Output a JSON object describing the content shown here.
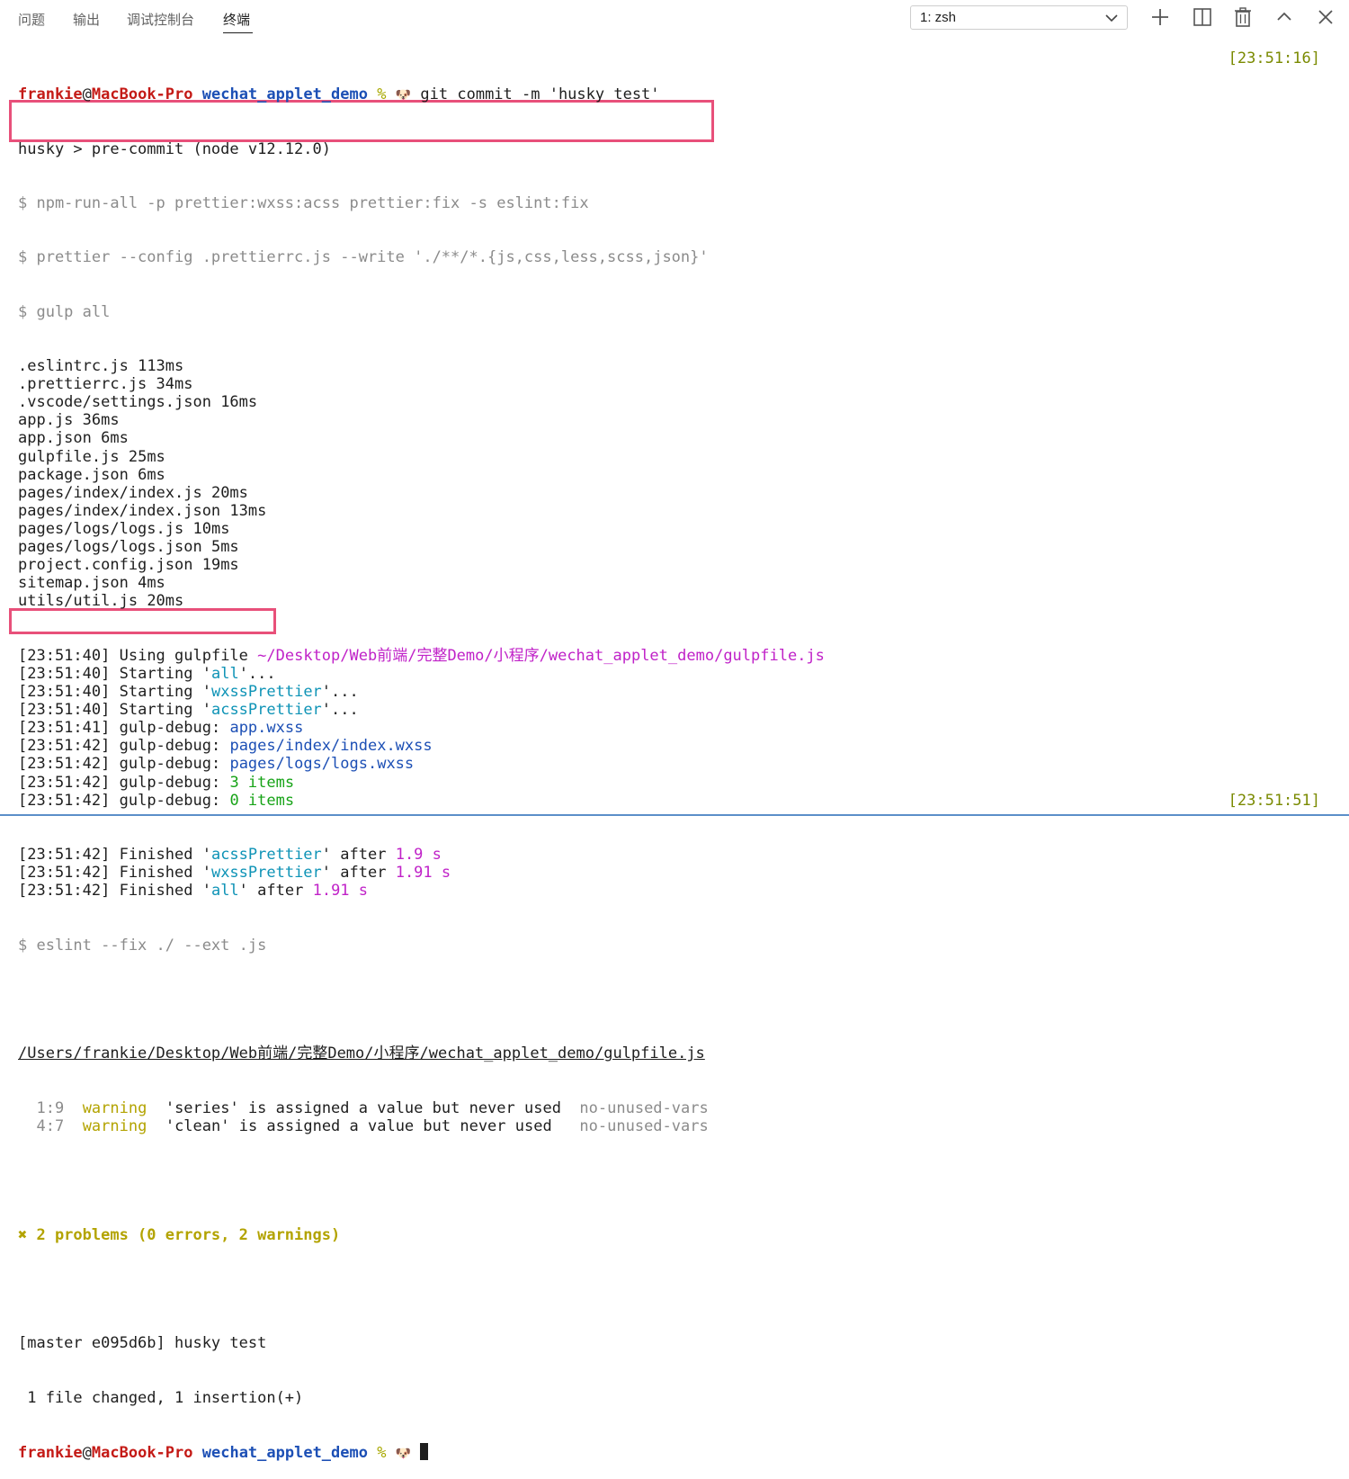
{
  "panel": {
    "tabs": [
      {
        "label": "问题"
      },
      {
        "label": "输出"
      },
      {
        "label": "调试控制台"
      },
      {
        "label": "终端"
      }
    ],
    "terminal_select": "1: zsh",
    "icons": [
      "plus-icon",
      "split-icon",
      "trash-icon",
      "chevron-up-icon",
      "close-icon"
    ]
  },
  "prompt": {
    "user": "frankie",
    "at": "@",
    "host": "MacBook-Pro",
    "dir": "wechat_applet_demo",
    "pct": "%",
    "dog": "🐶"
  },
  "first_command": "git commit -m 'husky test'",
  "first_time": "[23:51:16]",
  "last_time": "[23:51:51]",
  "lines": {
    "husky": "husky > pre-commit (node v12.12.0)",
    "npm_run_all": "$ npm-run-all -p prettier:wxss:acss prettier:fix -s eslint:fix",
    "prettier_cmd": "$ prettier --config .prettierrc.js --write './**/*.{js,css,less,scss,json}'",
    "gulp_all": "$ gulp all",
    "files": [
      {
        "name": ".eslintrc.js",
        "time": "113ms"
      },
      {
        "name": ".prettierrc.js",
        "time": "34ms"
      },
      {
        "name": ".vscode/settings.json",
        "time": "16ms"
      },
      {
        "name": "app.js",
        "time": "36ms"
      },
      {
        "name": "app.json",
        "time": "6ms"
      },
      {
        "name": "gulpfile.js",
        "time": "25ms"
      },
      {
        "name": "package.json",
        "time": "6ms"
      },
      {
        "name": "pages/index/index.js",
        "time": "20ms"
      },
      {
        "name": "pages/index/index.json",
        "time": "13ms"
      },
      {
        "name": "pages/logs/logs.js",
        "time": "10ms"
      },
      {
        "name": "pages/logs/logs.json",
        "time": "5ms"
      },
      {
        "name": "project.config.json",
        "time": "19ms"
      },
      {
        "name": "sitemap.json",
        "time": "4ms"
      },
      {
        "name": "utils/util.js",
        "time": "20ms"
      }
    ],
    "gulp": [
      {
        "ts": "[23:51:40]",
        "text": "Using gulpfile",
        "hi": "~/Desktop/Web前端/完整Demo/小程序/wechat_applet_demo/gulpfile.js",
        "cls": "magenta",
        "tail": ""
      },
      {
        "ts": "[23:51:40]",
        "text": "Starting '",
        "hi": "all",
        "cls": "cyan",
        "tail": "'..."
      },
      {
        "ts": "[23:51:40]",
        "text": "Starting '",
        "hi": "wxssPrettier",
        "cls": "cyan",
        "tail": "'..."
      },
      {
        "ts": "[23:51:40]",
        "text": "Starting '",
        "hi": "acssPrettier",
        "cls": "cyan",
        "tail": "'..."
      },
      {
        "ts": "[23:51:41]",
        "text": "gulp-debug:",
        "hi": "app.wxss",
        "cls": "blue",
        "tail": ""
      },
      {
        "ts": "[23:51:42]",
        "text": "gulp-debug:",
        "hi": "pages/index/index.wxss",
        "cls": "blue",
        "tail": ""
      },
      {
        "ts": "[23:51:42]",
        "text": "gulp-debug:",
        "hi": "pages/logs/logs.wxss",
        "cls": "blue",
        "tail": ""
      },
      {
        "ts": "[23:51:42]",
        "text": "gulp-debug:",
        "hi": "3 items",
        "cls": "green",
        "tail": ""
      },
      {
        "ts": "[23:51:42]",
        "text": "gulp-debug:",
        "hi": "0 items",
        "cls": "green",
        "tail": ""
      }
    ],
    "finished": [
      {
        "ts": "[23:51:42]",
        "name": "acssPrettier",
        "after": "after",
        "dur": "1.9 s"
      },
      {
        "ts": "[23:51:42]",
        "name": "wxssPrettier",
        "after": "after",
        "dur": "1.91 s"
      },
      {
        "ts": "[23:51:42]",
        "name": "all",
        "after": "after",
        "dur": "1.91 s"
      }
    ],
    "eslint_cmd": "$ eslint --fix ./ --ext .js",
    "eslint_path": "/Users/frankie/Desktop/Web前端/完整Demo/小程序/wechat_applet_demo/gulpfile.js",
    "warnings": [
      {
        "pos": "1:9",
        "level": "warning",
        "msg": "'series' is assigned a value but never used",
        "rule": "no-unused-vars"
      },
      {
        "pos": "4:7",
        "level": "warning",
        "msg": "'clean' is assigned a value but never used",
        "rule": "no-unused-vars"
      }
    ],
    "problems": "✖ 2 problems (0 errors, 2 warnings)",
    "commit": "[master e095d6b] husky test",
    "changed": " 1 file changed, 1 insertion(+)"
  },
  "colors": {
    "highlight_box": "#e8507a",
    "prompt_user": "#c41a16",
    "prompt_dir": "#1c4fb5"
  }
}
